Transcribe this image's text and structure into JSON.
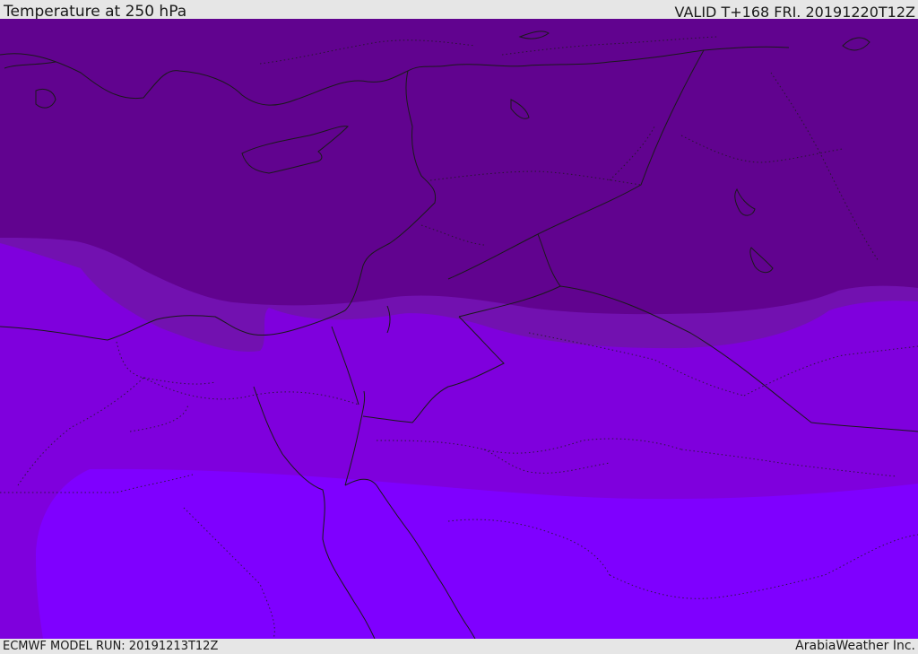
{
  "header": {
    "title": "Temperature at 250 hPa",
    "valid": "VALID T+168 FRI. 20191220T12Z"
  },
  "footer": {
    "model_run": "ECMWF MODEL RUN: 20191213T12Z",
    "credit": "ArabiaWeather Inc."
  },
  "map": {
    "colors": {
      "band_coldest": "#61038f",
      "band_cold": "#7211b0",
      "band_mid": "#7f00dd",
      "band_warm": "#7f00ff",
      "boundary_line": "#1a1a1a"
    }
  }
}
